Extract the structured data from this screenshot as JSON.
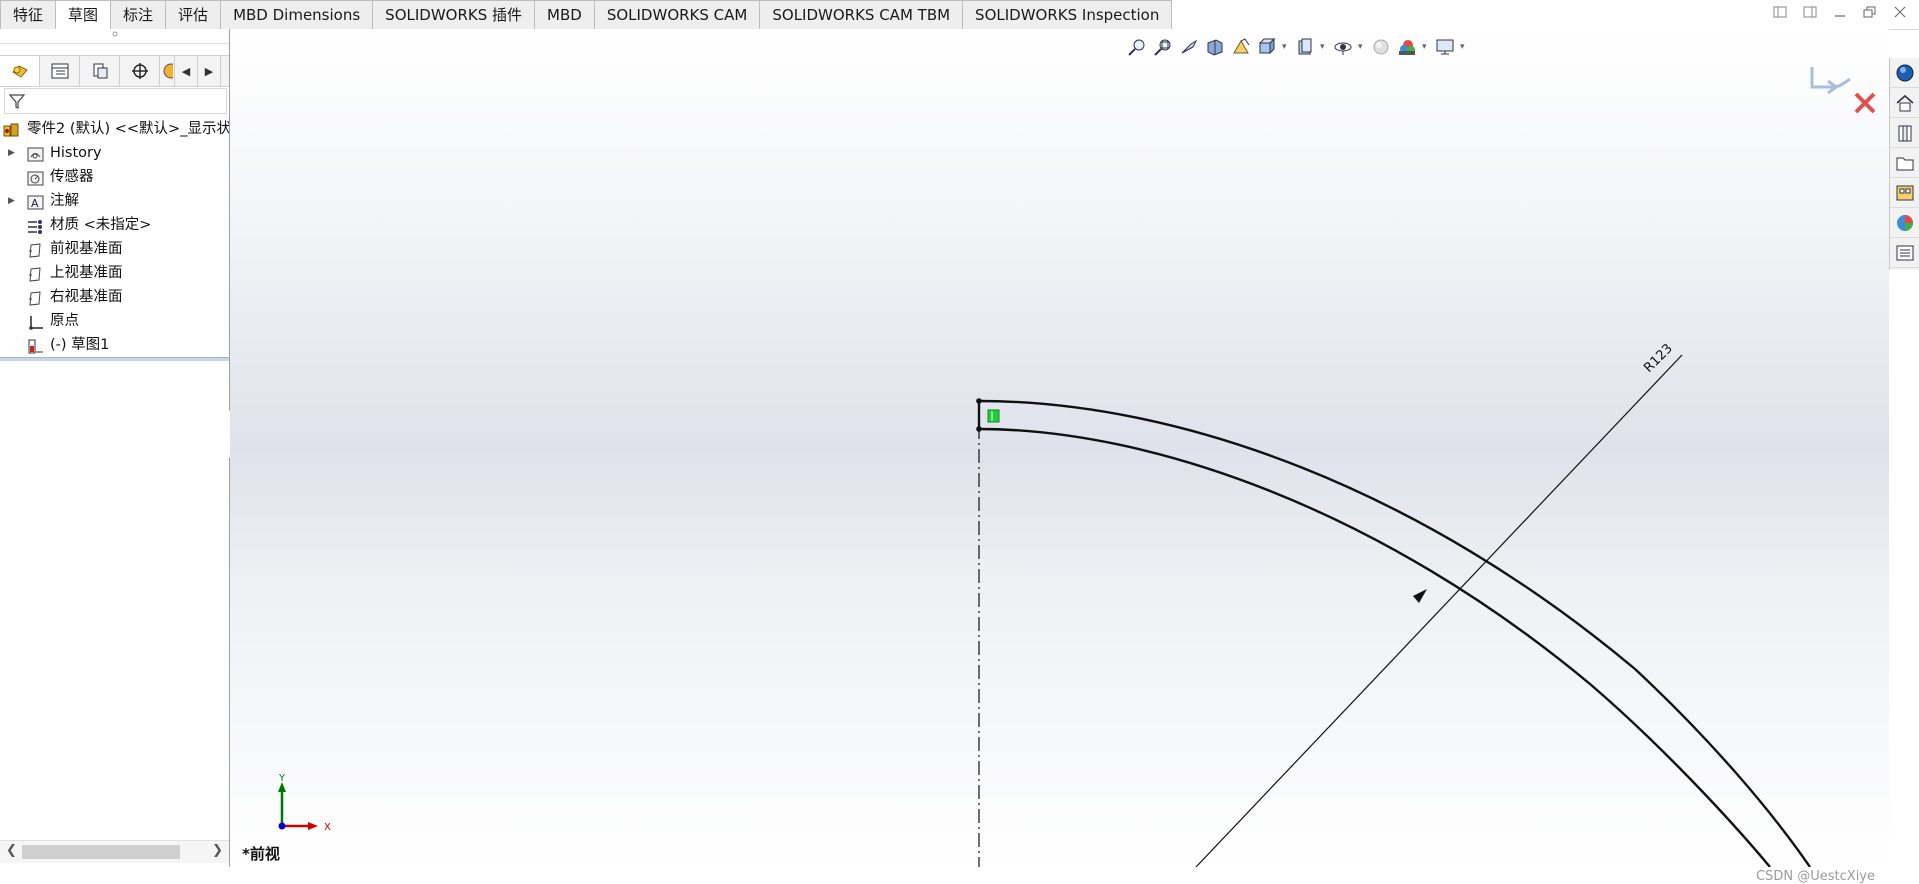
{
  "tabs": [
    {
      "label": "特征",
      "active": false
    },
    {
      "label": "草图",
      "active": true
    },
    {
      "label": "标注",
      "active": false
    },
    {
      "label": "评估",
      "active": false
    },
    {
      "label": "MBD Dimensions",
      "active": false
    },
    {
      "label": "SOLIDWORKS 插件",
      "active": false
    },
    {
      "label": "MBD",
      "active": false
    },
    {
      "label": "SOLIDWORKS CAM",
      "active": false
    },
    {
      "label": "SOLIDWORKS CAM TBM",
      "active": false
    },
    {
      "label": "SOLIDWORKS Inspection",
      "active": false
    }
  ],
  "feature_tree": {
    "root": "零件2 (默认) <<默认>_显示状",
    "items": [
      {
        "label": "History",
        "icon": "history-folder-icon",
        "expandable": true
      },
      {
        "label": "传感器",
        "icon": "sensor-icon",
        "expandable": false
      },
      {
        "label": "注解",
        "icon": "annotations-icon",
        "expandable": true
      },
      {
        "label": "材质 <未指定>",
        "icon": "material-icon",
        "expandable": false
      },
      {
        "label": "前视基准面",
        "icon": "plane-icon",
        "expandable": false
      },
      {
        "label": "上视基准面",
        "icon": "plane-icon",
        "expandable": false
      },
      {
        "label": "右视基准面",
        "icon": "plane-icon",
        "expandable": false
      },
      {
        "label": "原点",
        "icon": "origin-icon",
        "expandable": false
      },
      {
        "label": "(-) 草图1",
        "icon": "sketch-icon",
        "expandable": false
      }
    ]
  },
  "graphics": {
    "dimension_label": "R123",
    "view_name": "*前视",
    "triad": {
      "x": "X",
      "y": "Y"
    }
  },
  "watermark": "CSDN @UestcXiye",
  "colors": {
    "sketch_line": "#111111",
    "active_marker": "#22cc33",
    "triad_x": "#cc0000",
    "triad_y": "#007700",
    "triad_z": "#0000cc",
    "confirm_red": "#e05050"
  }
}
